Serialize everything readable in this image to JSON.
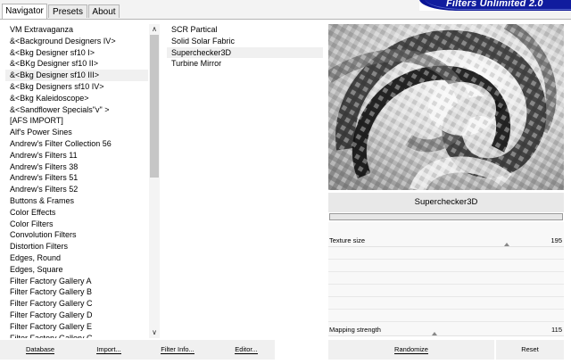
{
  "tabs": [
    "Navigator",
    "Presets",
    "About"
  ],
  "brand": "Filters Unlimited 2.0",
  "categories": [
    "VM Extravaganza",
    "&<Background Designers IV>",
    "&<Bkg Designer sf10 I>",
    "&<BKg Designer sf10 II>",
    "&<Bkg Designer sf10 III>",
    "&<Bkg Designers sf10 IV>",
    "&<Bkg Kaleidoscope>",
    "&<Sandflower Specials\"v\" >",
    "[AFS IMPORT]",
    "Alf's Power Sines",
    "Andrew's Filter Collection 56",
    "Andrew's Filters 11",
    "Andrew's Filters 38",
    "Andrew's Filters 51",
    "Andrew's Filters 52",
    "Buttons & Frames",
    "Color Effects",
    "Color Filters",
    "Convolution Filters",
    "Distortion Filters",
    "Edges, Round",
    "Edges, Square",
    "Filter Factory Gallery A",
    "Filter Factory Gallery B",
    "Filter Factory Gallery C",
    "Filter Factory Gallery D",
    "Filter Factory Gallery E",
    "Filter Factory Gallery G"
  ],
  "selected_category": "&<Bkg Designer sf10 III>",
  "filters": [
    "SCR  Partical",
    "Solid Solar Fabric",
    "Superchecker3D",
    "Turbine Mirror"
  ],
  "selected_filter": "Superchecker3D",
  "filter_title": "Superchecker3D",
  "params": [
    {
      "label": "Texture size",
      "value": "195",
      "level": 195
    },
    {
      "label": "Mapping strength",
      "value": "115",
      "level": 115
    }
  ],
  "buttons": {
    "database": "Database",
    "import": "Import...",
    "filter_info": "Filter Info...",
    "editor": "Editor...",
    "randomize": "Randomize",
    "reset": "Reset"
  },
  "scroll": {
    "up": "∧",
    "down": "∨"
  },
  "colors": {
    "brand": "#0b1596",
    "selected_bg": "#f0f0f0"
  },
  "icons": {
    "scroll_up": "chevron-up-icon",
    "scroll_down": "chevron-down-icon"
  }
}
